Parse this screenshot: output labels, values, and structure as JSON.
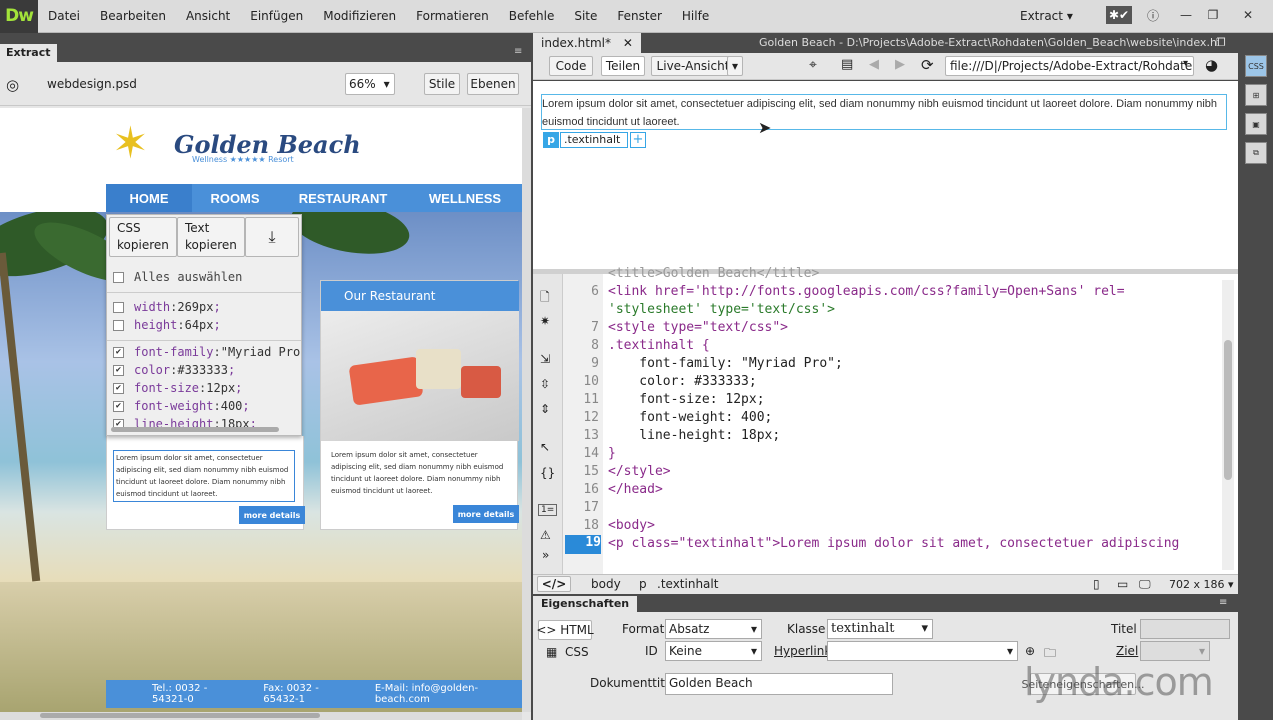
{
  "app": {
    "logo": "Dw",
    "workspace": "Extract"
  },
  "menu": [
    "Datei",
    "Bearbeiten",
    "Ansicht",
    "Einfügen",
    "Modifizieren",
    "Formatieren",
    "Befehle",
    "Site",
    "Fenster",
    "Hilfe"
  ],
  "left": {
    "tab": "Extract",
    "file": "webdesign.psd",
    "zoom": "66%",
    "btn_stile": "Stile",
    "btn_ebenen": "Ebenen"
  },
  "site": {
    "brand": "Golden Beach",
    "tagline": "Wellness ★★★★★ Resort",
    "nav": [
      "HOME",
      "ROOMS",
      "RESTAURANT",
      "WELLNESS"
    ],
    "restaurant_title": "Our Restaurant",
    "card_text": "Lorem ipsum dolor sit amet, consectetuer adipiscing elit, sed diam nonummy nibh euismod tincidunt ut laoreet dolore. Diam nonummy nibh euismod tincidunt ut laoreet.",
    "more": "more details",
    "footer": [
      "Tel.: 0032 - 54321-0",
      "Fax: 0032 - 65432-1",
      "E-Mail: info@golden-beach.com"
    ]
  },
  "extract": {
    "copy_css": "CSS kopieren",
    "copy_text": "Text kopieren",
    "select_all": "Alles auswählen",
    "rows": [
      {
        "prop": "width",
        "val": "269px",
        "checked": false
      },
      {
        "prop": "height",
        "val": "64px",
        "checked": false
      },
      {
        "prop": "font-family",
        "val": "\"Myriad Pro",
        "checked": true
      },
      {
        "prop": "color",
        "val": "#333333",
        "checked": true
      },
      {
        "prop": "font-size",
        "val": "12px",
        "checked": true
      },
      {
        "prop": "font-weight",
        "val": "400",
        "checked": true
      },
      {
        "prop": "line-height",
        "val": "18px",
        "checked": true
      }
    ]
  },
  "doc": {
    "tab": "index.html*",
    "path_title": "Golden Beach - D:\\Projects\\Adobe-Extract\\Rohdaten\\Golden_Beach\\website\\index.html",
    "btn_code": "Code",
    "btn_split": "Teilen",
    "btn_live": "Live-Ansicht",
    "address": "file:///D|/Projects/Adobe-Extract/Rohdaten/Gc",
    "live_text": "Lorem ipsum dolor sit amet, consectetuer adipiscing elit, sed diam nonummy nibh euismod tincidunt ut laoreet dolore. Diam nonummy nibh euismod tincidunt ut laoreet.",
    "el_tag": "p",
    "el_class": ".textinhalt"
  },
  "code": {
    "lines": [
      "6",
      "",
      "7",
      "8",
      "9",
      "10",
      "11",
      "12",
      "13",
      "14",
      "15",
      "16",
      "17",
      "18",
      "19"
    ],
    "partial_top": "<title>Golden Beach</title>",
    "l6a": "<link href='http://fonts.googleapis.com/css?family=Open+Sans' rel=",
    "l6b": "'stylesheet' type='text/css'>",
    "l7": "<style type=\"text/css\">",
    "l8": ".textinhalt {",
    "l9": "    font-family: \"Myriad Pro\";",
    "l10": "    color: #333333;",
    "l11": "    font-size: 12px;",
    "l12": "    font-weight: 400;",
    "l13": "    line-height: 18px;",
    "l14": "}",
    "l15": "</style>",
    "l16": "</head>",
    "l18": "<body>",
    "l19": "<p class=\"textinhalt\">Lorem ipsum dolor sit amet, consectetuer adipiscing"
  },
  "tagselector": {
    "root": "</>",
    "body": "body",
    "p": "p",
    "cls": ".textinhalt",
    "size": "702 x 186"
  },
  "props": {
    "title": "Eigenschaften",
    "html": "HTML",
    "css": "CSS",
    "format_label": "Format",
    "format_val": "Absatz",
    "klasse_label": "Klasse",
    "klasse_val": "textinhalt",
    "titel_label": "Titel",
    "id_label": "ID",
    "id_val": "Keine",
    "hyperlink_label": "Hyperlink",
    "ziel_label": "Ziel",
    "doctitle_label": "Dokumenttitel",
    "doctitle_val": "Golden Beach",
    "seite_label": "Seiteneigenschaften..."
  },
  "watermark": "lynda.com"
}
